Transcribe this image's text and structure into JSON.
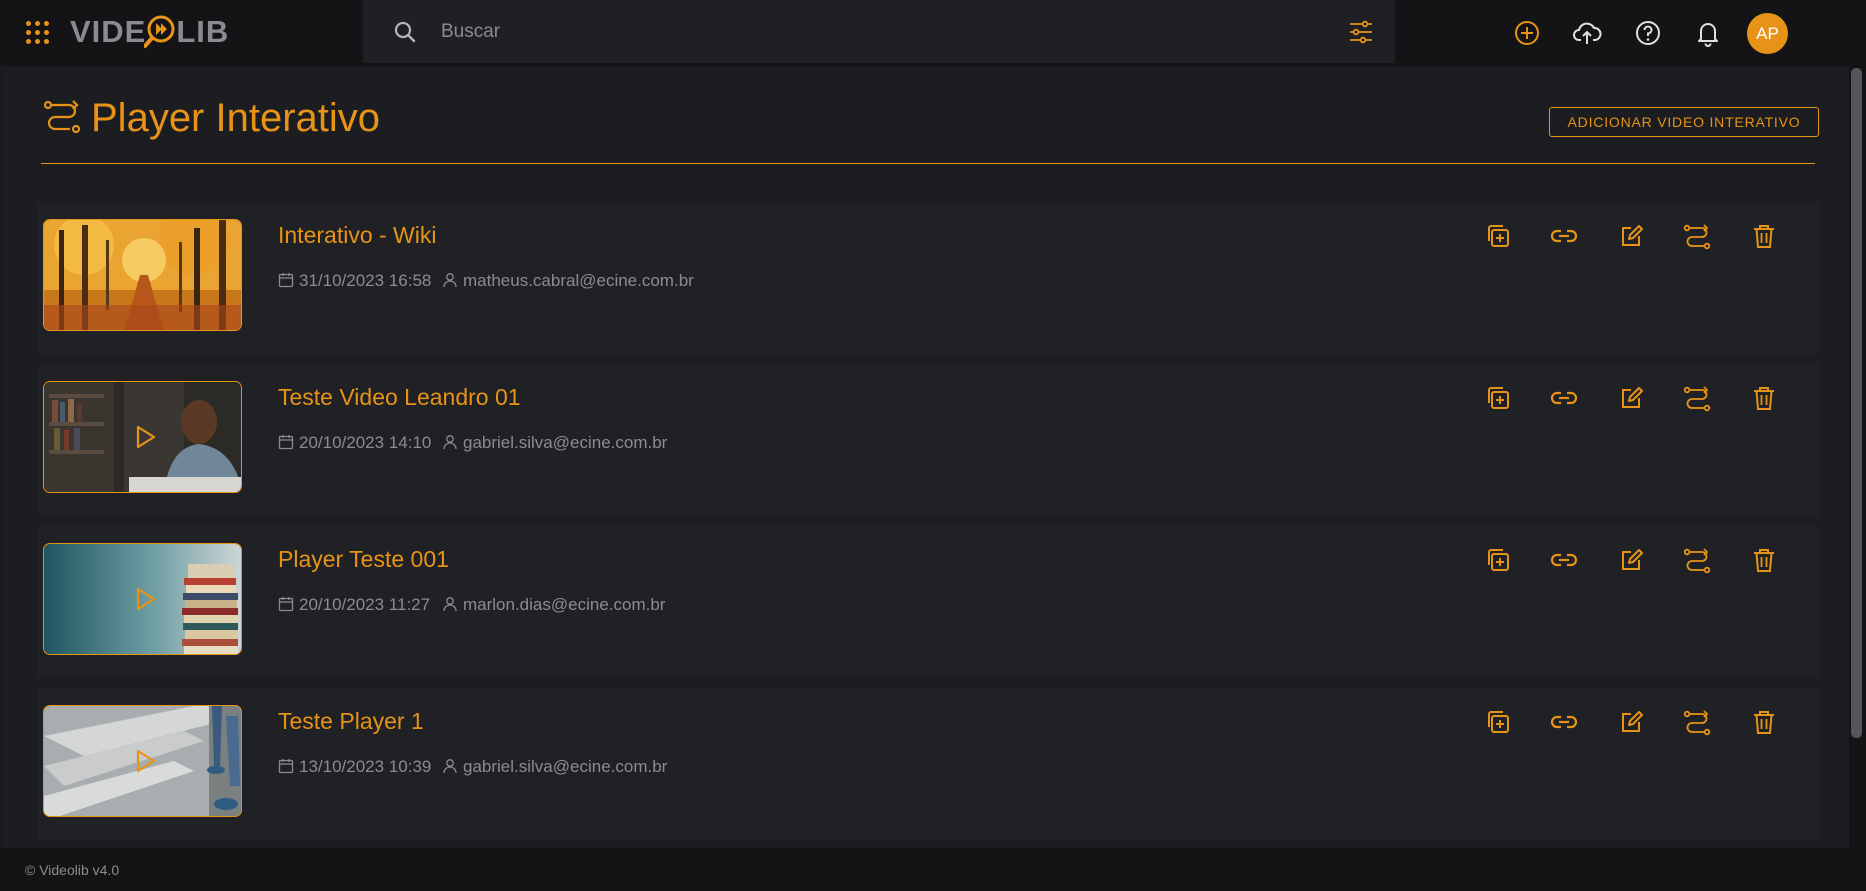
{
  "header": {
    "logo_text_left": "VIDE",
    "logo_text_right": "LIB",
    "search_placeholder": "Buscar",
    "icons": [
      "apps-grid-icon",
      "search-icon",
      "filter-sliders-icon",
      "add-circle-icon",
      "cloud-upload-icon",
      "help-icon",
      "bell-icon"
    ],
    "avatar_initials": "AP"
  },
  "page": {
    "title": "Player Interativo",
    "add_button_label": "ADICIONAR VIDEO INTERATIVO"
  },
  "rows": [
    {
      "title": "Interativo - Wiki",
      "date": "31/10/2023 16:58",
      "user": "matheus.cabral@ecine.com.br",
      "thumbnail": "autumn-forest-path"
    },
    {
      "title": "Teste Video Leandro 01",
      "date": "20/10/2023 14:10",
      "user": "gabriel.silva@ecine.com.br",
      "thumbnail": "man-smiling-at-desk"
    },
    {
      "title": "Player Teste 001",
      "date": "20/10/2023 11:27",
      "user": "marlon.dias@ecine.com.br",
      "thumbnail": "stack-of-books"
    },
    {
      "title": "Teste Player 1",
      "date": "13/10/2023 10:39",
      "user": "gabriel.silva@ecine.com.br",
      "thumbnail": "person-walking-stairs"
    }
  ],
  "row_actions": [
    "duplicate-icon",
    "link-icon",
    "edit-icon",
    "interactive-flow-icon",
    "trash-icon"
  ],
  "footer": {
    "text": "© Videolib v4.0"
  },
  "colors": {
    "accent": "#e69318",
    "background": "#1a1b1e",
    "row": "#202124",
    "muted_text": "#8b8c90"
  }
}
